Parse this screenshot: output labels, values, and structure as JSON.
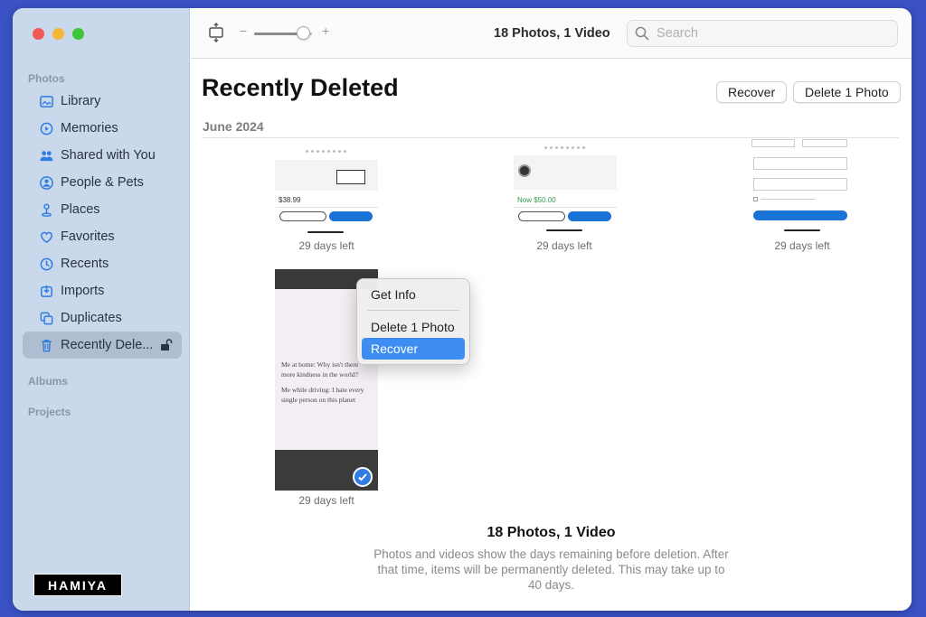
{
  "sidebar": {
    "section_photos": "Photos",
    "items": [
      {
        "label": "Library",
        "icon": "library-icon"
      },
      {
        "label": "Memories",
        "icon": "memories-icon"
      },
      {
        "label": "Shared with You",
        "icon": "shared-icon"
      },
      {
        "label": "People & Pets",
        "icon": "people-icon"
      },
      {
        "label": "Places",
        "icon": "places-icon"
      },
      {
        "label": "Favorites",
        "icon": "heart-icon"
      },
      {
        "label": "Recents",
        "icon": "clock-icon"
      },
      {
        "label": "Imports",
        "icon": "import-icon"
      },
      {
        "label": "Duplicates",
        "icon": "duplicates-icon"
      },
      {
        "label": "Recently Dele...",
        "icon": "trash-icon",
        "active": true
      }
    ],
    "section_albums": "Albums",
    "section_projects": "Projects"
  },
  "toolbar": {
    "zoom_minus": "−",
    "zoom_plus": "+",
    "zoom_level": 0.85,
    "count": "18 Photos, 1 Video",
    "search_placeholder": "Search"
  },
  "main": {
    "title": "Recently Deleted",
    "recover_label": "Recover",
    "delete_label": "Delete 1 Photo",
    "date": "June 2024",
    "thumbs": [
      {
        "caption": "29 days left"
      },
      {
        "caption": "29 days left"
      },
      {
        "caption": "29 days left"
      },
      {
        "caption": "29 days left"
      }
    ]
  },
  "thumb_content": {
    "price_1": "$38.99",
    "price_2": "Now $50.00",
    "post_line_1": "Me at home: Why isn't there more kindness in the world?",
    "post_line_2": "Me while driving: I hate every single person on this planet"
  },
  "context_menu": {
    "get_info": "Get Info",
    "delete": "Delete 1 Photo",
    "recover": "Recover"
  },
  "footer": {
    "title": "18 Photos, 1 Video",
    "description": "Photos and videos show the days remaining before deletion. After that time, items will be permanently deleted. This may take up to 40 days."
  },
  "watermark": "HAMIYA",
  "colors": {
    "sidebar_bg": "#c9d8ea",
    "accent": "#3d8ef0",
    "background": "#3a52c4"
  }
}
